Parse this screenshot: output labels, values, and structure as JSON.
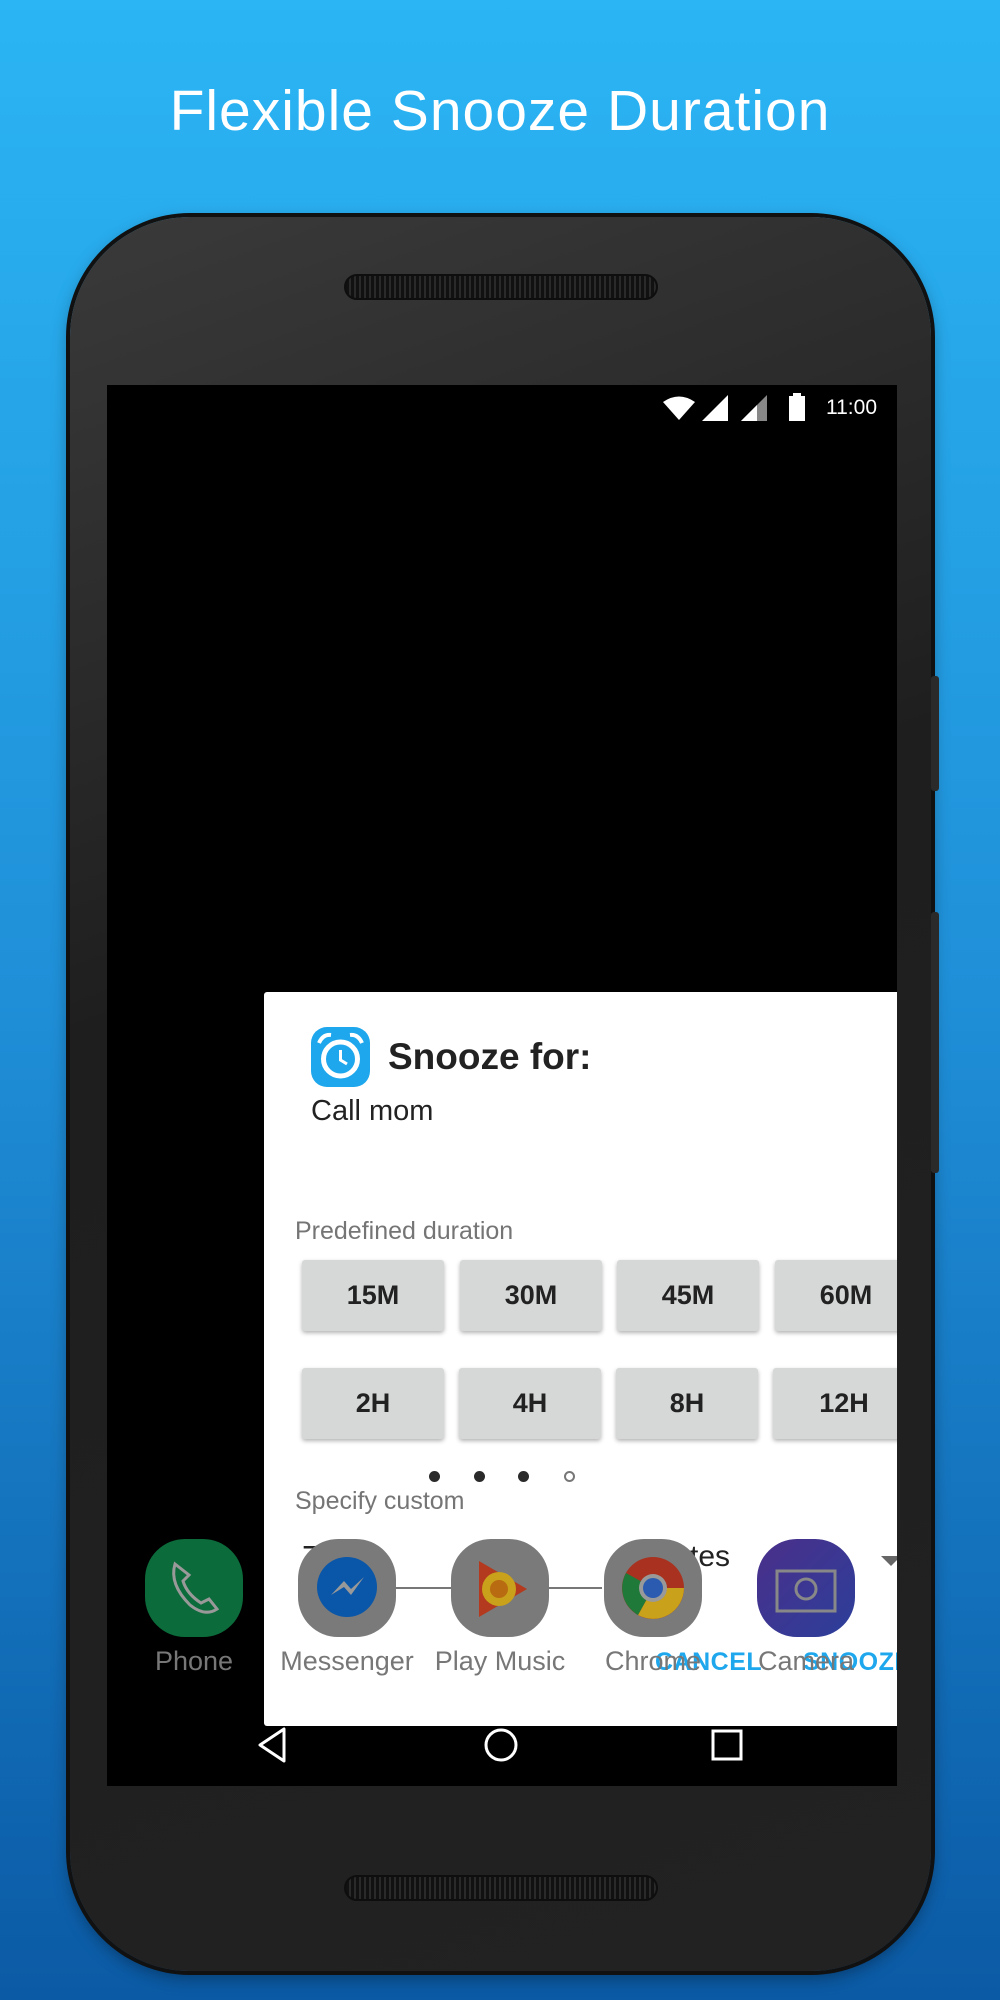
{
  "headline": "Flexible Snooze Duration",
  "status_bar": {
    "time": "11:00",
    "icons": [
      "wifi-icon",
      "signal-icon",
      "signal-icon",
      "battery-icon"
    ]
  },
  "dialog": {
    "title": "Snooze for:",
    "subtitle": "Call mom",
    "app_icon": "alarm-clock-icon",
    "predefined_label": "Predefined duration",
    "durations": [
      "15M",
      "30M",
      "45M",
      "60M",
      "2H",
      "4H",
      "8H",
      "12H"
    ],
    "custom_label": "Specify custom",
    "custom_value": "7",
    "unit": "Minutes",
    "cancel": "CANCEL",
    "snooze": "SNOOZE",
    "accent": "#1ea7ec"
  },
  "home": {
    "page_count": 4,
    "current_page": 4,
    "dock": [
      {
        "label": "Phone",
        "icon": "phone-icon",
        "color": "#0b6b3a"
      },
      {
        "label": "Messenger",
        "icon": "messenger-icon",
        "color": "#7a7a7a"
      },
      {
        "label": "Play Music",
        "icon": "play-music-icon",
        "color": "#7a7a7a"
      },
      {
        "label": "Chrome",
        "icon": "chrome-icon",
        "color": "#7a7a7a"
      },
      {
        "label": "Camera",
        "icon": "camera-icon",
        "color": "#3c3a8a"
      }
    ]
  }
}
